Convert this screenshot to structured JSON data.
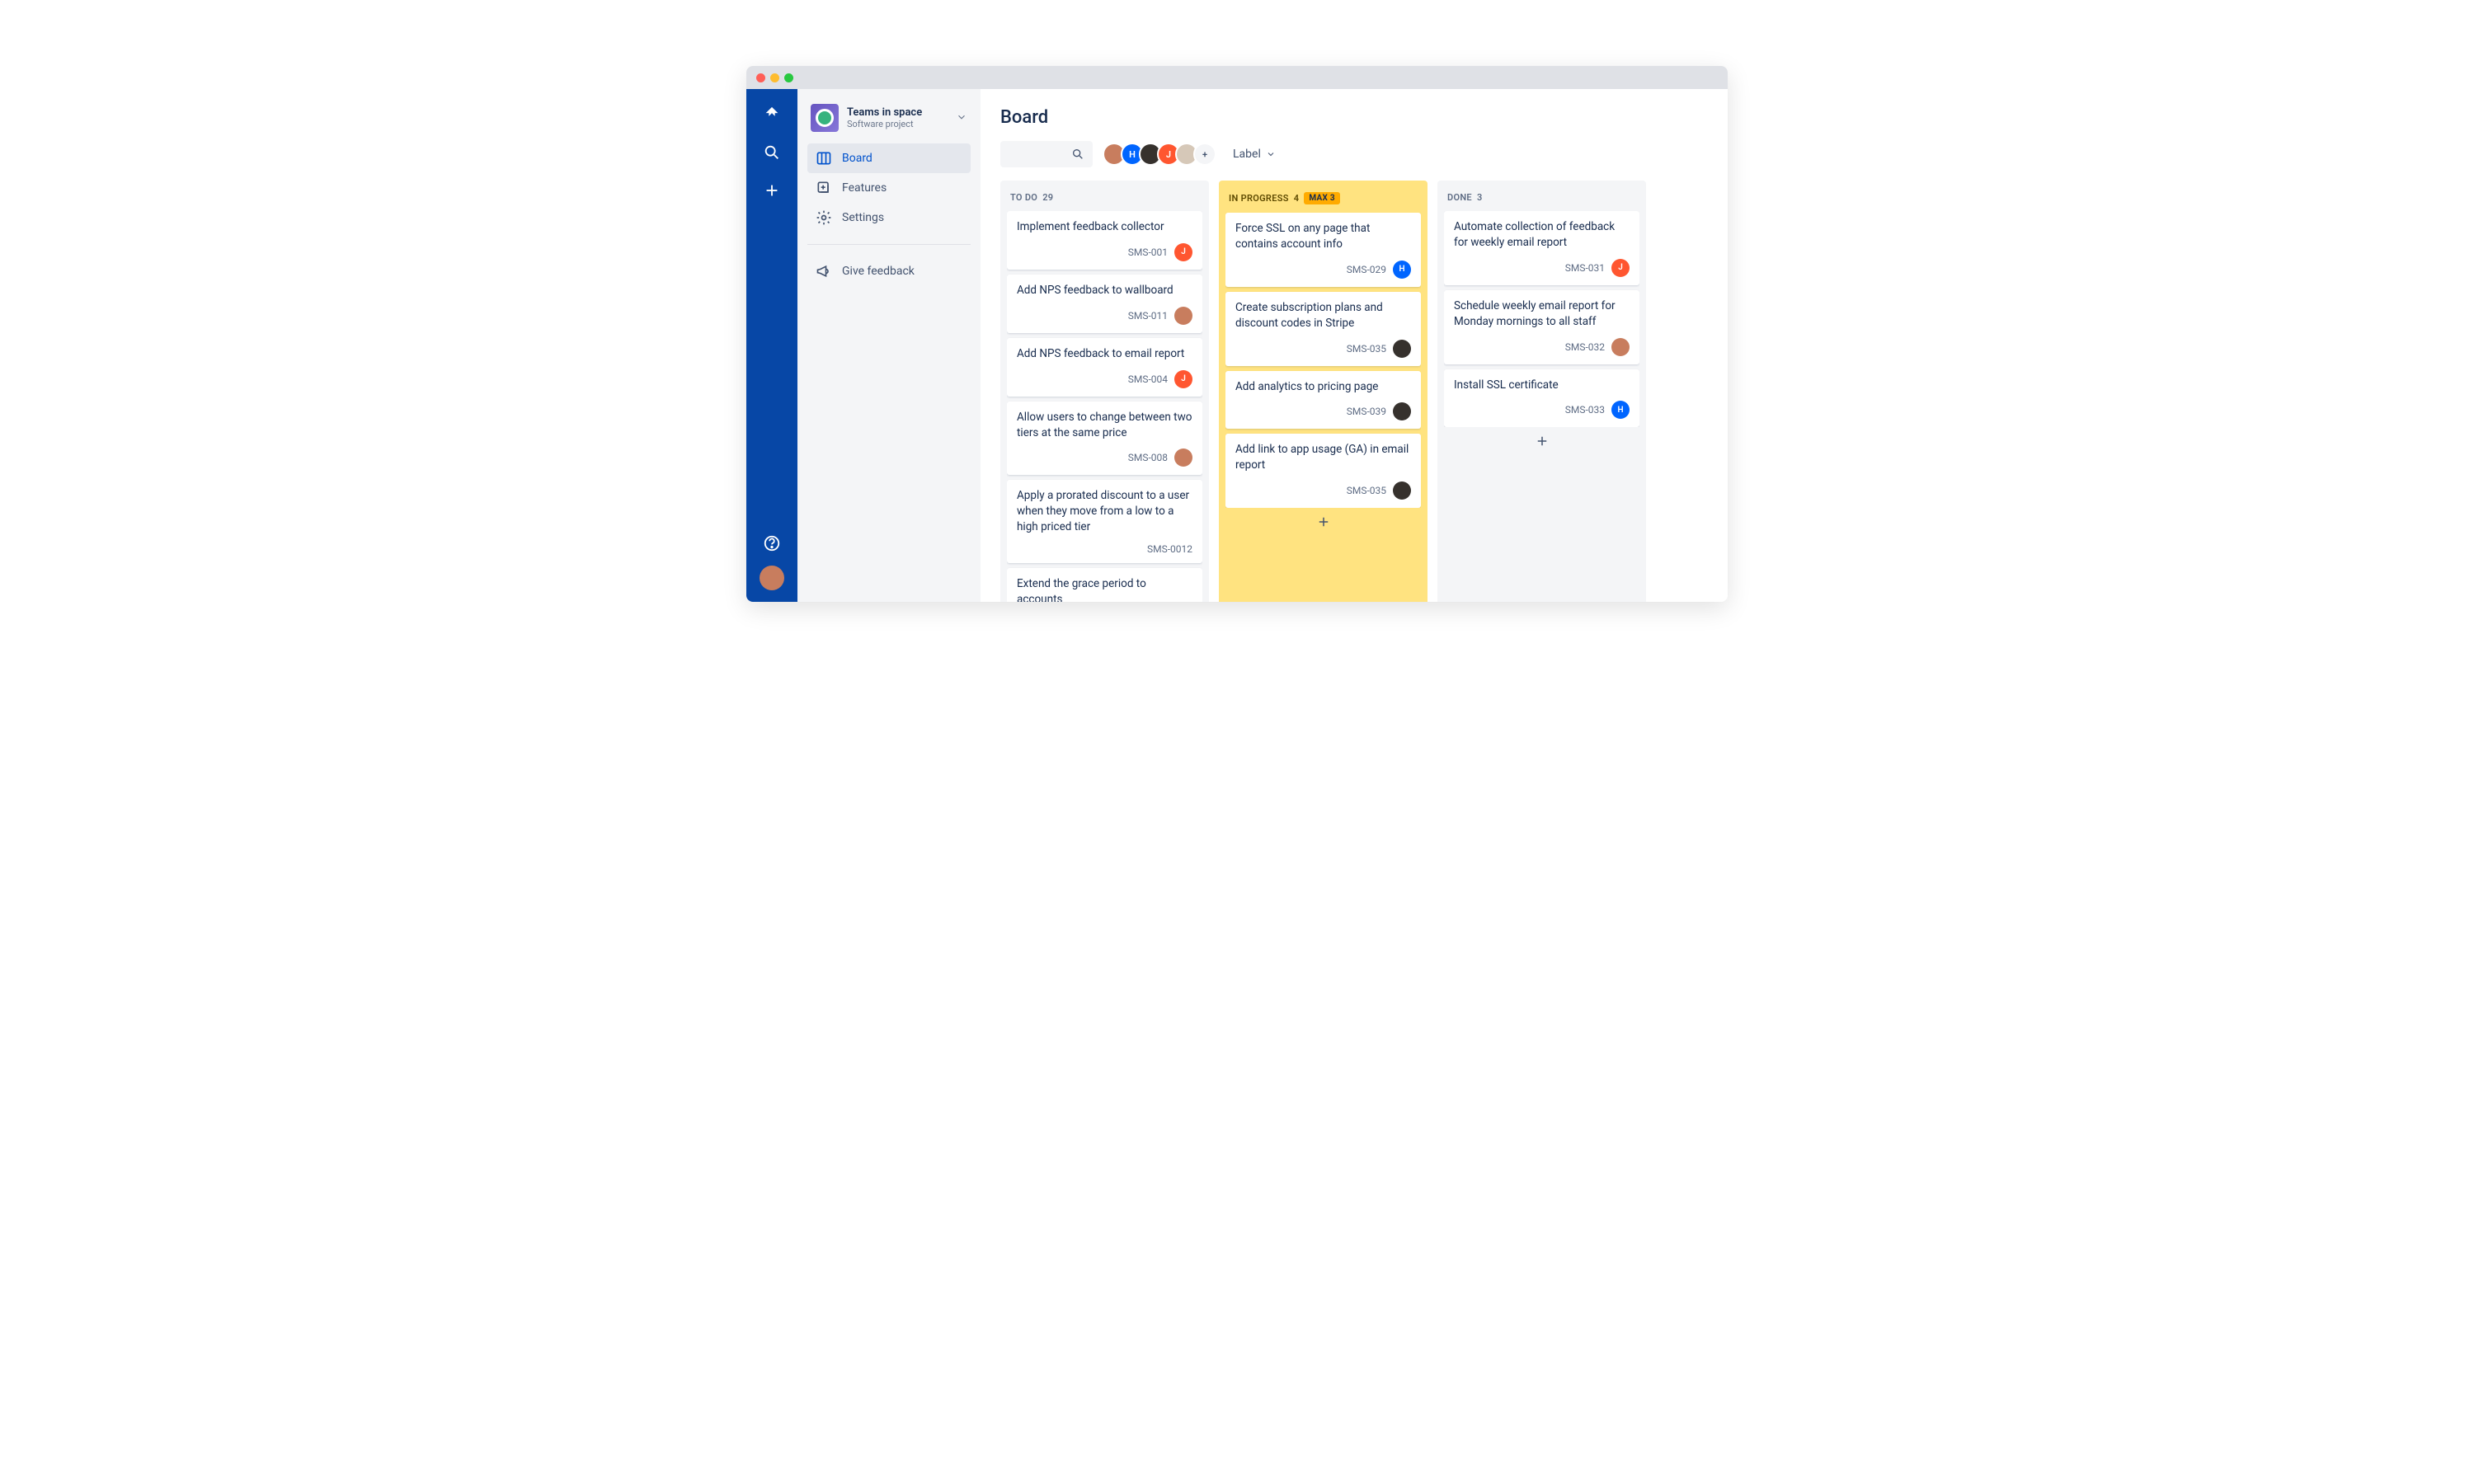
{
  "project": {
    "name": "Teams in space",
    "type": "Software project"
  },
  "nav": {
    "board": "Board",
    "features": "Features",
    "settings": "Settings",
    "feedback": "Give feedback"
  },
  "page_title": "Board",
  "toolbar": {
    "label_filter": "Label"
  },
  "avatars": [
    {
      "initial": "",
      "color": "#c87d5e"
    },
    {
      "initial": "H",
      "color": "#0065ff"
    },
    {
      "initial": "",
      "color": "#36312d"
    },
    {
      "initial": "J",
      "color": "#ff5630"
    },
    {
      "initial": "",
      "color": "#d6c8b8"
    }
  ],
  "columns": [
    {
      "key": "todo",
      "name": "TO DO",
      "count": "29",
      "warn": false,
      "max": null,
      "cards": [
        {
          "title": "Implement feedback collector",
          "id": "SMS-001",
          "assignee": {
            "initial": "J",
            "color": "#ff5630"
          }
        },
        {
          "title": "Add NPS feedback to wallboard",
          "id": "SMS-011",
          "assignee": {
            "initial": "",
            "color": "#c87d5e"
          }
        },
        {
          "title": "Add NPS feedback to email report",
          "id": "SMS-004",
          "assignee": {
            "initial": "J",
            "color": "#ff5630"
          }
        },
        {
          "title": "Allow users to change between two tiers at the same price",
          "id": "SMS-008",
          "assignee": {
            "initial": "",
            "color": "#c87d5e"
          }
        },
        {
          "title": "Apply a prorated discount to a user when they move from a low to a high priced tier",
          "id": "SMS-0012",
          "assignee": null
        },
        {
          "title": "Extend the grace period to accounts",
          "id": "",
          "assignee": null
        }
      ]
    },
    {
      "key": "inprogress",
      "name": "IN PROGRESS",
      "count": "4",
      "warn": true,
      "max": "MAX 3",
      "cards": [
        {
          "title": "Force SSL on any page that contains account info",
          "id": "SMS-029",
          "assignee": {
            "initial": "H",
            "color": "#0065ff"
          }
        },
        {
          "title": "Create subscription plans and discount codes in Stripe",
          "id": "SMS-035",
          "assignee": {
            "initial": "",
            "color": "#36312d"
          }
        },
        {
          "title": "Add analytics to pricing page",
          "id": "SMS-039",
          "assignee": {
            "initial": "",
            "color": "#36312d"
          }
        },
        {
          "title": "Add link to app usage (GA) in email report",
          "id": "SMS-035",
          "assignee": {
            "initial": "",
            "color": "#36312d"
          }
        }
      ]
    },
    {
      "key": "done",
      "name": "DONE",
      "count": "3",
      "warn": false,
      "max": null,
      "cards": [
        {
          "title": "Automate collection of feedback for weekly email report",
          "id": "SMS-031",
          "assignee": {
            "initial": "J",
            "color": "#ff5630"
          }
        },
        {
          "title": "Schedule weekly email report for Monday mornings to all staff",
          "id": "SMS-032",
          "assignee": {
            "initial": "",
            "color": "#c87d5e"
          }
        },
        {
          "title": "Install SSL certificate",
          "id": "SMS-033",
          "assignee": {
            "initial": "H",
            "color": "#0065ff"
          }
        }
      ]
    }
  ]
}
